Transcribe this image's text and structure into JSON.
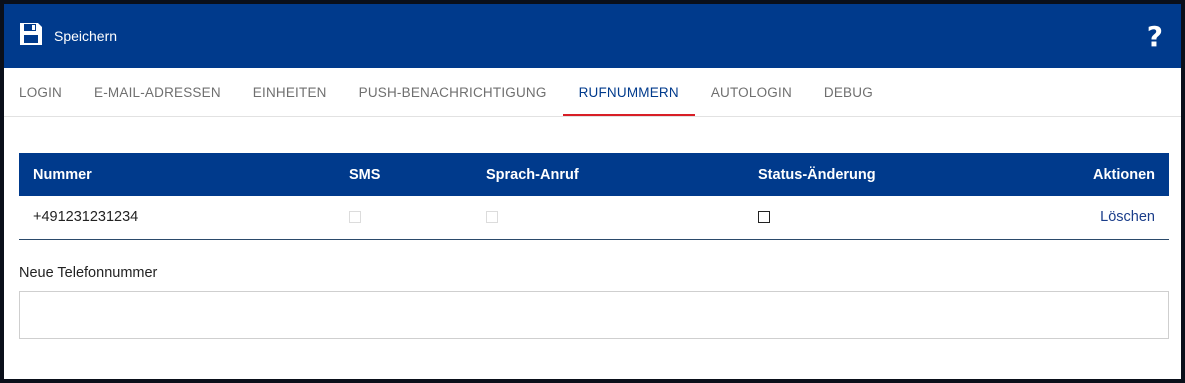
{
  "toolbar": {
    "save_label": "Speichern",
    "help_label": "?"
  },
  "tabs": [
    {
      "label": "LOGIN"
    },
    {
      "label": "E-MAIL-ADRESSEN"
    },
    {
      "label": "EINHEITEN"
    },
    {
      "label": "PUSH-BENACHRICHTIGUNG"
    },
    {
      "label": "RUFNUMMERN",
      "active": true
    },
    {
      "label": "AUTOLOGIN"
    },
    {
      "label": "DEBUG"
    }
  ],
  "table": {
    "headers": {
      "number": "Nummer",
      "sms": "SMS",
      "voice_call": "Sprach-Anruf",
      "status_change": "Status-Änderung",
      "actions": "Aktionen"
    },
    "rows": [
      {
        "number": "+491231231234",
        "sms": false,
        "voice_call": false,
        "status_change": false,
        "action_label": "Löschen"
      }
    ]
  },
  "new_number": {
    "label": "Neue Telefonnummer",
    "value": "",
    "placeholder": ""
  },
  "colors": {
    "primary": "#003a8c",
    "tab_indicator": "#d81e26"
  },
  "icons": {
    "save": "floppy-disk-icon",
    "help": "question-mark-icon"
  }
}
